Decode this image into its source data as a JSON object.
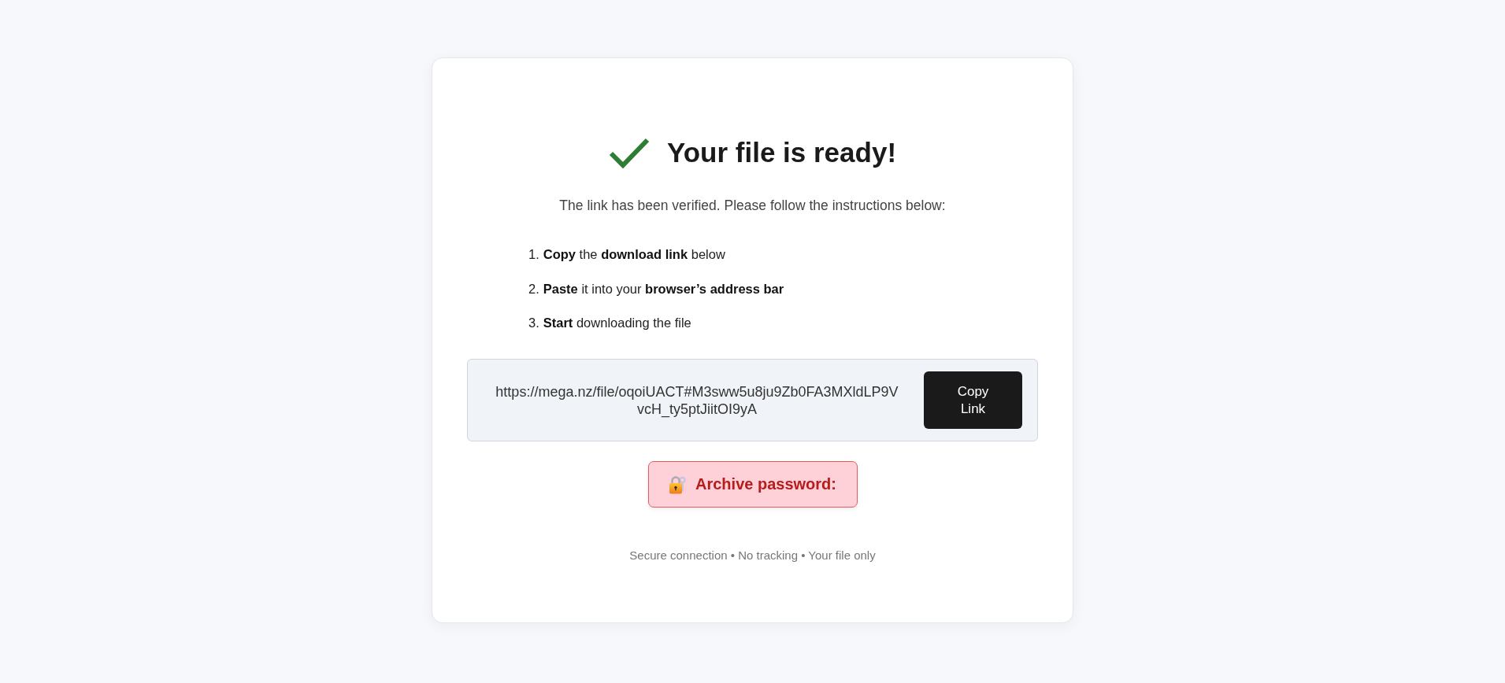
{
  "header": {
    "title": "Your file is ready!"
  },
  "intro": "The link has been verified. Please follow the instructions below:",
  "steps": [
    {
      "number": "1.",
      "text": "**Copy** the **download link** below"
    },
    {
      "number": "2.",
      "text": "**Paste** it into your **browser’s address bar**"
    },
    {
      "number": "3.",
      "text": "**Start** downloading the file"
    }
  ],
  "link_box": {
    "url": "https://mega.nz/file/oqoiUACT#M3sww5u8ju9Zb0FA3MXldLP9VvcH_ty5ptJiitOI9yA",
    "button": "Copy Link"
  },
  "password_notice": {
    "label": "Archive password:"
  },
  "footer": "Secure connection • No tracking • Your file only"
}
